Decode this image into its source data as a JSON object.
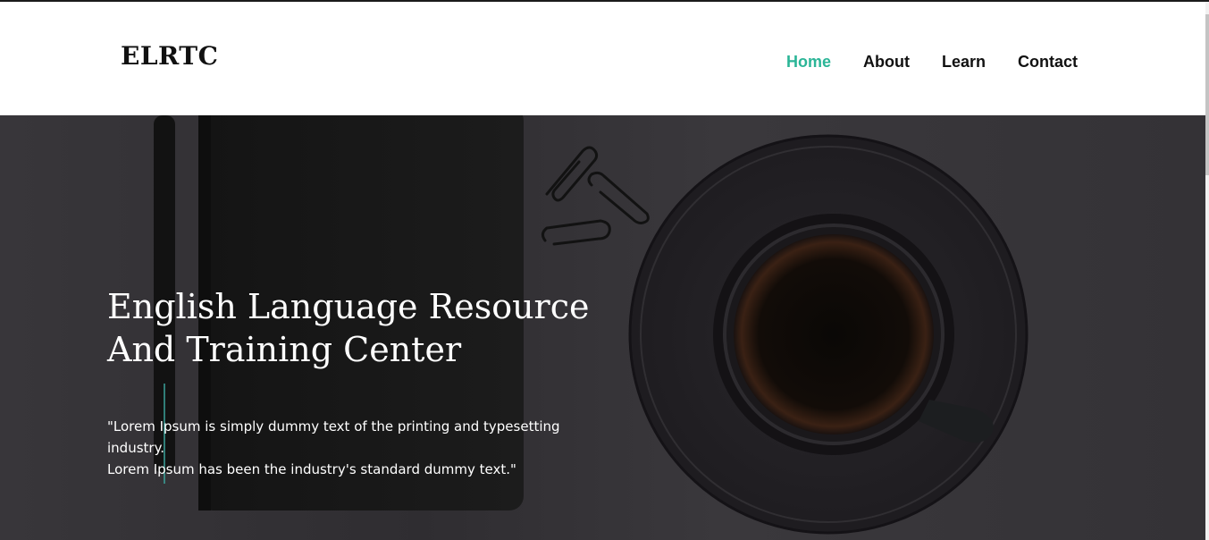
{
  "header": {
    "logo": "ELRTC",
    "nav": [
      {
        "label": "Home",
        "active": true
      },
      {
        "label": "About",
        "active": false
      },
      {
        "label": "Learn",
        "active": false
      },
      {
        "label": "Contact",
        "active": false
      }
    ]
  },
  "hero": {
    "title_line1": "English Language Resource",
    "title_line2": "And Training Center",
    "text_line1": "\"Lorem Ipsum is simply dummy text of the printing and typesetting industry.",
    "text_line2": "Lorem Ipsum has been the industry's standard dummy text.\""
  },
  "colors": {
    "accent": "#2bb597",
    "nav_text": "#111111",
    "hero_bg": "#38363a",
    "hero_text": "#ffffff"
  }
}
